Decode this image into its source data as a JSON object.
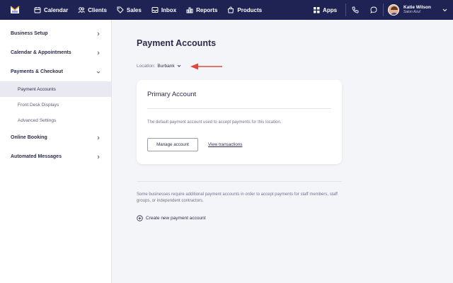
{
  "nav": {
    "items": [
      {
        "label": "Calendar",
        "icon": "calendar-icon"
      },
      {
        "label": "Clients",
        "icon": "clients-icon"
      },
      {
        "label": "Sales",
        "icon": "tag-icon"
      },
      {
        "label": "Inbox",
        "icon": "inbox-icon"
      },
      {
        "label": "Reports",
        "icon": "bar-chart-icon"
      },
      {
        "label": "Products",
        "icon": "bag-icon"
      }
    ],
    "apps_label": "Apps",
    "user": {
      "name": "Katie Wilson",
      "business": "Salon Azul"
    },
    "colors": {
      "bar": "#1f2354",
      "logo_accent": "#f0a23b"
    }
  },
  "sidebar": {
    "items": [
      {
        "label": "Business Setup"
      },
      {
        "label": "Calendar & Appointments"
      },
      {
        "label": "Payments & Checkout"
      },
      {
        "label": "Online Booking"
      },
      {
        "label": "Automated Messages"
      }
    ],
    "subitems": [
      {
        "label": "Payment Accounts"
      },
      {
        "label": "Front Desk Displays"
      },
      {
        "label": "Advanced Settings"
      }
    ]
  },
  "main": {
    "title": "Payment Accounts",
    "location_label": "Location:",
    "location_value": "Burbank",
    "card": {
      "title": "Primary Account",
      "description": "The default payment account used to accept payments for this location.",
      "manage_label": "Manage account",
      "view_label": "View transactions"
    },
    "note": "Some businesses require additional payment accounts in order to accept payments for staff members, staff groups, or independent contractors.",
    "create_label": "Create new payment account",
    "arrow_color": "#e0483a"
  }
}
